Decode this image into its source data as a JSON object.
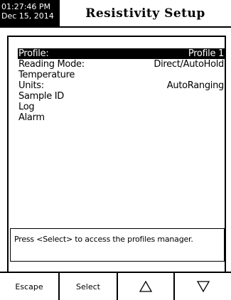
{
  "header": {
    "time": "01:27:46 PM",
    "date": "Dec 15, 2014",
    "title": "Resistivity Setup"
  },
  "menu": {
    "items": [
      {
        "label": "Profile:",
        "value": "Profile 1",
        "selected": true
      },
      {
        "label": "Reading Mode:",
        "value": "Direct/AutoHold",
        "selected": false
      },
      {
        "label": "Temperature",
        "value": "",
        "selected": false
      },
      {
        "label": "Units:",
        "value": "AutoRanging",
        "selected": false
      },
      {
        "label": "Sample ID",
        "value": "",
        "selected": false
      },
      {
        "label": "Log",
        "value": "",
        "selected": false
      },
      {
        "label": "Alarm",
        "value": "",
        "selected": false
      }
    ]
  },
  "help": {
    "text": "Press <Select> to access the profiles manager."
  },
  "softkeys": {
    "escape": "Escape",
    "select": "Select",
    "up_icon": "up-triangle-icon",
    "down_icon": "down-triangle-icon"
  },
  "colors": {
    "background": "#ffffff",
    "foreground": "#000000",
    "selection": "#000000"
  }
}
